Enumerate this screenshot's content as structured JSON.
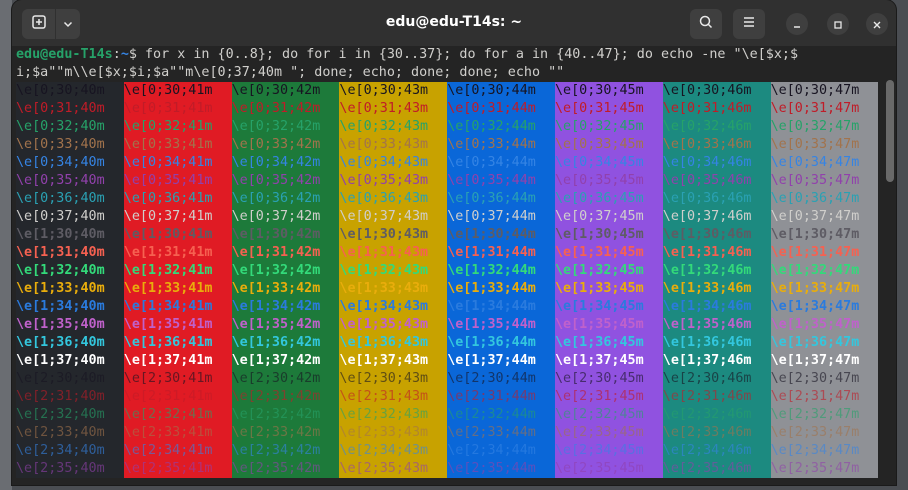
{
  "window": {
    "title": "edu@edu-T14s: ~"
  },
  "icons": {
    "new_tab": "new-tab-icon",
    "tab_menu": "chevron-down-icon",
    "search": "search-icon",
    "menu": "hamburger-menu-icon",
    "minimize": "minimize-icon",
    "maximize": "maximize-icon",
    "close": "close-icon"
  },
  "prompt": {
    "user_host": "edu@edu-T14s",
    "separator": ":",
    "path": "~",
    "symbol": "$",
    "command_line_1": " for x in {0..8}; do for i in {30..37}; do for a in {40..47}; do echo -ne \"\\e[$x;$",
    "command_line_2": "i;$a\"\"m\\\\e[$x;$i;$a\"\"m\\e[0;37;40m \"; done; echo; done; done; echo \"\""
  },
  "palette": {
    "fg": {
      "30": "#171421",
      "31": "#c01c28",
      "32": "#26a269",
      "33": "#a2734c",
      "34": "#3584e4",
      "35": "#9141ac",
      "36": "#2aa1b3",
      "37": "#d0cfcc"
    },
    "fg_bold": {
      "30": "#5e5c64",
      "31": "#f66151",
      "32": "#33da7a",
      "33": "#e9ad0c",
      "34": "#2a7bde",
      "35": "#c061cb",
      "36": "#33c7de",
      "37": "#ffffff"
    },
    "bg": {
      "40": "#24272c",
      "41": "#e01b24",
      "42": "#1d7a3a",
      "43": "#c8a200",
      "44": "#0a67d8",
      "45": "#9052e0",
      "46": "#1c8a80",
      "47": "#8f9196"
    }
  },
  "grid": {
    "codes": [
      [
        "\\e[0;30;40m",
        "\\e[0;30;41m",
        "\\e[0;30;42m",
        "\\e[0;30;43m",
        "\\e[0;30;44m",
        "\\e[0;30;45m",
        "\\e[0;30;46m",
        "\\e[0;30;47m"
      ],
      [
        "\\e[0;31;40m",
        "\\e[0;31;41m",
        "\\e[0;31;42m",
        "\\e[0;31;43m",
        "\\e[0;31;44m",
        "\\e[0;31;45m",
        "\\e[0;31;46m",
        "\\e[0;31;47m"
      ],
      [
        "\\e[0;32;40m",
        "\\e[0;32;41m",
        "\\e[0;32;42m",
        "\\e[0;32;43m",
        "\\e[0;32;44m",
        "\\e[0;32;45m",
        "\\e[0;32;46m",
        "\\e[0;32;47m"
      ],
      [
        "\\e[0;33;40m",
        "\\e[0;33;41m",
        "\\e[0;33;42m",
        "\\e[0;33;43m",
        "\\e[0;33;44m",
        "\\e[0;33;45m",
        "\\e[0;33;46m",
        "\\e[0;33;47m"
      ],
      [
        "\\e[0;34;40m",
        "\\e[0;34;41m",
        "\\e[0;34;42m",
        "\\e[0;34;43m",
        "\\e[0;34;44m",
        "\\e[0;34;45m",
        "\\e[0;34;46m",
        "\\e[0;34;47m"
      ],
      [
        "\\e[0;35;40m",
        "\\e[0;35;41m",
        "\\e[0;35;42m",
        "\\e[0;35;43m",
        "\\e[0;35;44m",
        "\\e[0;35;45m",
        "\\e[0;35;46m",
        "\\e[0;35;47m"
      ],
      [
        "\\e[0;36;40m",
        "\\e[0;36;41m",
        "\\e[0;36;42m",
        "\\e[0;36;43m",
        "\\e[0;36;44m",
        "\\e[0;36;45m",
        "\\e[0;36;46m",
        "\\e[0;36;47m"
      ],
      [
        "\\e[0;37;40m",
        "\\e[0;37;41m",
        "\\e[0;37;42m",
        "\\e[0;37;43m",
        "\\e[0;37;44m",
        "\\e[0;37;45m",
        "\\e[0;37;46m",
        "\\e[0;37;47m"
      ],
      [
        "\\e[1;30;40m",
        "\\e[1;30;41m",
        "\\e[1;30;42m",
        "\\e[1;30;43m",
        "\\e[1;30;44m",
        "\\e[1;30;45m",
        "\\e[1;30;46m",
        "\\e[1;30;47m"
      ],
      [
        "\\e[1;31;40m",
        "\\e[1;31;41m",
        "\\e[1;31;42m",
        "\\e[1;31;43m",
        "\\e[1;31;44m",
        "\\e[1;31;45m",
        "\\e[1;31;46m",
        "\\e[1;31;47m"
      ],
      [
        "\\e[1;32;40m",
        "\\e[1;32;41m",
        "\\e[1;32;42m",
        "\\e[1;32;43m",
        "\\e[1;32;44m",
        "\\e[1;32;45m",
        "\\e[1;32;46m",
        "\\e[1;32;47m"
      ],
      [
        "\\e[1;33;40m",
        "\\e[1;33;41m",
        "\\e[1;33;42m",
        "\\e[1;33;43m",
        "\\e[1;33;44m",
        "\\e[1;33;45m",
        "\\e[1;33;46m",
        "\\e[1;33;47m"
      ],
      [
        "\\e[1;34;40m",
        "\\e[1;34;41m",
        "\\e[1;34;42m",
        "\\e[1;34;43m",
        "\\e[1;34;44m",
        "\\e[1;34;45m",
        "\\e[1;34;46m",
        "\\e[1;34;47m"
      ],
      [
        "\\e[1;35;40m",
        "\\e[1;35;41m",
        "\\e[1;35;42m",
        "\\e[1;35;43m",
        "\\e[1;35;44m",
        "\\e[1;35;45m",
        "\\e[1;35;46m",
        "\\e[1;35;47m"
      ],
      [
        "\\e[1;36;40m",
        "\\e[1;36;41m",
        "\\e[1;36;42m",
        "\\e[1;36;43m",
        "\\e[1;36;44m",
        "\\e[1;36;45m",
        "\\e[1;36;46m",
        "\\e[1;36;47m"
      ],
      [
        "\\e[1;37;40m",
        "\\e[1;37;41m",
        "\\e[1;37;42m",
        "\\e[1;37;43m",
        "\\e[1;37;44m",
        "\\e[1;37;45m",
        "\\e[1;37;46m",
        "\\e[1;37;47m"
      ],
      [
        "\\e[2;30;40m",
        "\\e[2;30;41m",
        "\\e[2;30;42m",
        "\\e[2;30;43m",
        "\\e[2;30;44m",
        "\\e[2;30;45m",
        "\\e[2;30;46m",
        "\\e[2;30;47m"
      ],
      [
        "\\e[2;31;40m",
        "\\e[2;31;41m",
        "\\e[2;31;42m",
        "\\e[2;31;43m",
        "\\e[2;31;44m",
        "\\e[2;31;45m",
        "\\e[2;31;46m",
        "\\e[2;31;47m"
      ],
      [
        "\\e[2;32;40m",
        "\\e[2;32;41m",
        "\\e[2;32;42m",
        "\\e[2;32;43m",
        "\\e[2;32;44m",
        "\\e[2;32;45m",
        "\\e[2;32;46m",
        "\\e[2;32;47m"
      ],
      [
        "\\e[2;33;40m",
        "\\e[2;33;41m",
        "\\e[2;33;42m",
        "\\e[2;33;43m",
        "\\e[2;33;44m",
        "\\e[2;33;45m",
        "\\e[2;33;46m",
        "\\e[2;33;47m"
      ],
      [
        "\\e[2;34;40m",
        "\\e[2;34;41m",
        "\\e[2;34;42m",
        "\\e[2;34;43m",
        "\\e[2;34;44m",
        "\\e[2;34;45m",
        "\\e[2;34;46m",
        "\\e[2;34;47m"
      ],
      [
        "\\e[2;35;40m",
        "\\e[2;35;41m",
        "\\e[2;35;42m",
        "\\e[2;35;43m",
        "\\e[2;35;44m",
        "\\e[2;35;45m",
        "\\e[2;35;46m",
        "\\e[2;35;47m"
      ]
    ]
  }
}
